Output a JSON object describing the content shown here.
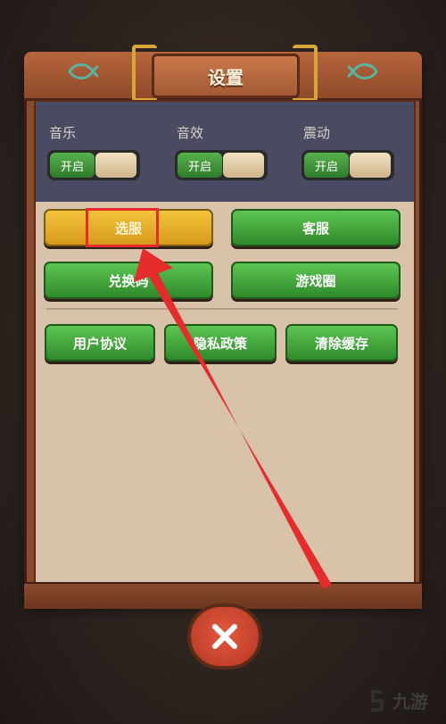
{
  "header": {
    "title": "设置"
  },
  "settings": [
    {
      "label": "音乐",
      "toggle_text": "开启"
    },
    {
      "label": "音效",
      "toggle_text": "开启"
    },
    {
      "label": "震动",
      "toggle_text": "开启"
    }
  ],
  "buttons": {
    "select_server": "选服",
    "customer_service": "客服",
    "redeem_code": "兑换码",
    "game_circle": "游戏圈",
    "user_agreement": "用户协议",
    "privacy_policy": "隐私政策",
    "clear_cache": "清除缓存"
  },
  "watermark": {
    "text": "九游"
  },
  "colors": {
    "accent_green": "#2f8a2a",
    "accent_yellow": "#d79a1c",
    "annotation_red": "#e52b2b"
  }
}
